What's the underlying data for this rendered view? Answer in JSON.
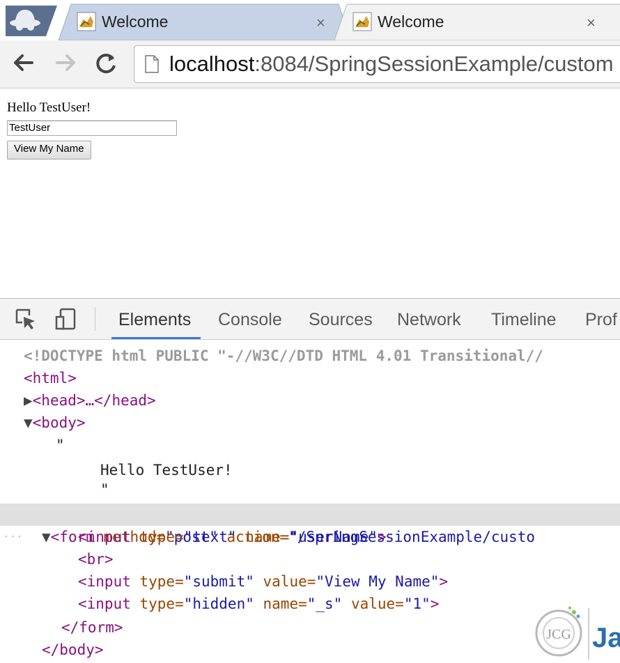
{
  "browser": {
    "tabs": [
      {
        "title": "Welcome",
        "close": "×",
        "active": false
      },
      {
        "title": "Welcome",
        "close": "×",
        "active": true
      }
    ],
    "nav": {
      "back": "back-icon",
      "forward": "forward-icon",
      "reload": "reload-icon"
    },
    "url": {
      "host": "localhost",
      "rest": ":8084/SpringSessionExample/custom"
    }
  },
  "page": {
    "greeting": "Hello TestUser!",
    "input_value": "TestUser",
    "submit_label": "View My Name"
  },
  "devtools": {
    "tabs": [
      "Elements",
      "Console",
      "Sources",
      "Network",
      "Timeline",
      "Prof"
    ],
    "active_tab": "Elements",
    "doctype": "<!DOCTYPE html PUBLIC \"-//W3C//DTD HTML 4.01 Transitional//",
    "html_open": "<html>",
    "head_line": "<head>…</head>",
    "body_open": "<body>",
    "quote1": "\"",
    "text_node": "Hello TestUser!",
    "quote2": "\"",
    "form_line": {
      "tag": "<form",
      "attr1": " method=",
      "val1": "\"post\"",
      "attr2": " action=",
      "val2": "\"/SpringSessionExample/custo"
    },
    "input1": {
      "tag": "<input",
      "a1": " type=",
      "v1": "\"text\"",
      "a2": " name=",
      "v2": "\"userName\"",
      "end": ">"
    },
    "br": "<br>",
    "input2": {
      "tag": "<input",
      "a1": " type=",
      "v1": "\"submit\"",
      "a2": " value=",
      "v2": "\"View My Name\"",
      "end": ">"
    },
    "input3": {
      "tag": "<input",
      "a1": " type=",
      "v1": "\"hidden\"",
      "a2": " name=",
      "v2": "\"_s\"",
      "a3": " value=",
      "v3": "\"1\"",
      "end": ">"
    },
    "form_close": "</form>",
    "body_close": "</body>",
    "gutter_dots": "···"
  },
  "watermark": {
    "logo_text": "JCG",
    "brand": "Jav"
  },
  "colors": {
    "tag": "#881280",
    "attr": "#994500",
    "value": "#1a1aa6",
    "accent": "#3879d9"
  }
}
